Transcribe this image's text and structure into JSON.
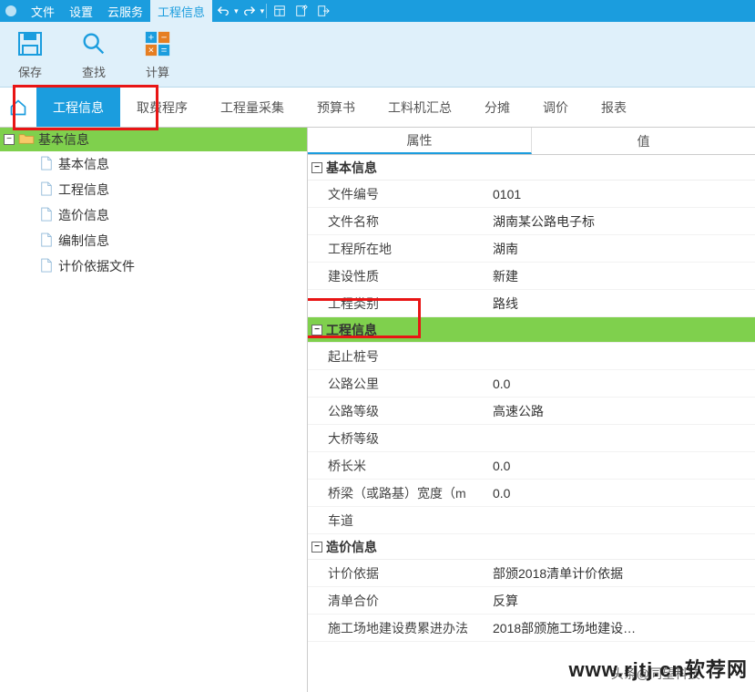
{
  "menubar": {
    "items": [
      "文件",
      "设置",
      "云服务",
      "工程信息"
    ],
    "active_index": 3
  },
  "ribbon": {
    "save": "保存",
    "search": "查找",
    "calc": "计算"
  },
  "navtabs": {
    "items": [
      "工程信息",
      "取费程序",
      "工程量采集",
      "预算书",
      "工料机汇总",
      "分摊",
      "调价",
      "报表"
    ],
    "active_index": 0
  },
  "tree": {
    "root": "基本信息",
    "children": [
      "基本信息",
      "工程信息",
      "造价信息",
      "编制信息",
      "计价依据文件"
    ]
  },
  "grid": {
    "headers": [
      "属性",
      "值"
    ],
    "groups": [
      {
        "name": "基本信息",
        "highlighted": false,
        "rows": [
          {
            "name": "文件编号",
            "value": "0101"
          },
          {
            "name": "文件名称",
            "value": "湖南某公路电子标"
          },
          {
            "name": "工程所在地",
            "value": "湖南"
          },
          {
            "name": "建设性质",
            "value": "新建"
          },
          {
            "name": "工程类别",
            "value": "路线"
          }
        ]
      },
      {
        "name": "工程信息",
        "highlighted": true,
        "rows": [
          {
            "name": "起止桩号",
            "value": ""
          },
          {
            "name": "公路公里",
            "value": "0.0"
          },
          {
            "name": "公路等级",
            "value": "高速公路"
          },
          {
            "name": "大桥等级",
            "value": ""
          },
          {
            "name": "桥长米",
            "value": "0.0"
          },
          {
            "name": "桥梁（或路基）宽度（m",
            "value": "0.0"
          },
          {
            "name": "车道",
            "value": ""
          }
        ]
      },
      {
        "name": "造价信息",
        "highlighted": false,
        "rows": [
          {
            "name": "计价依据",
            "value": "部颁2018清单计价依据"
          },
          {
            "name": "清单合价",
            "value": "反算"
          },
          {
            "name": "施工场地建设费累进办法",
            "value": "2018部颁施工场地建设…"
          }
        ]
      }
    ]
  },
  "watermark": "www.rjtj.cn软荐网",
  "watermark2": "头条@同望科技"
}
